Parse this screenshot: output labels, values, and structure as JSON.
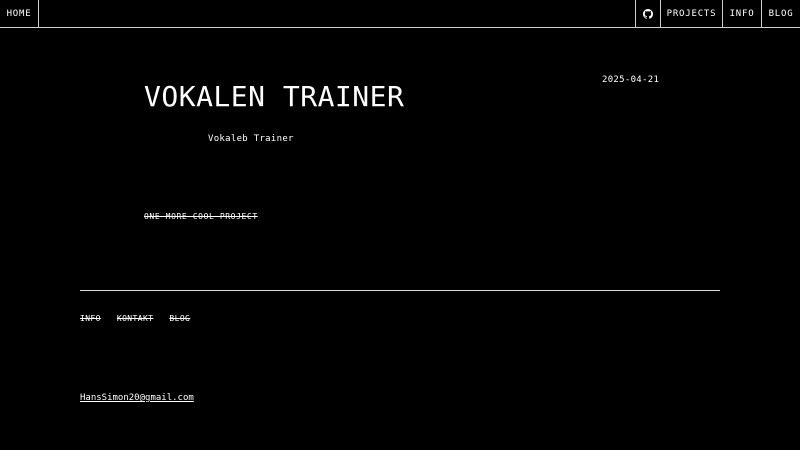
{
  "nav": {
    "home_label": "HOME",
    "github_icon": "github-icon",
    "projects_label": "PROJECTS",
    "info_label": "INFO",
    "blog_label": "BLOG"
  },
  "project": {
    "title": "VOKALEN TRAINER",
    "date": "2025-04-21",
    "subtitle": "Vokaleb Trainer",
    "tagline": "ONE MORE COOL PROJECT"
  },
  "footer": {
    "links": [
      "INFO",
      "KONTAKT",
      "BLOG"
    ],
    "email": "HansSimon20@gmail.com"
  },
  "colors": {
    "background": "#000000",
    "text": "#ffffff",
    "border": "#cfcfcf"
  }
}
